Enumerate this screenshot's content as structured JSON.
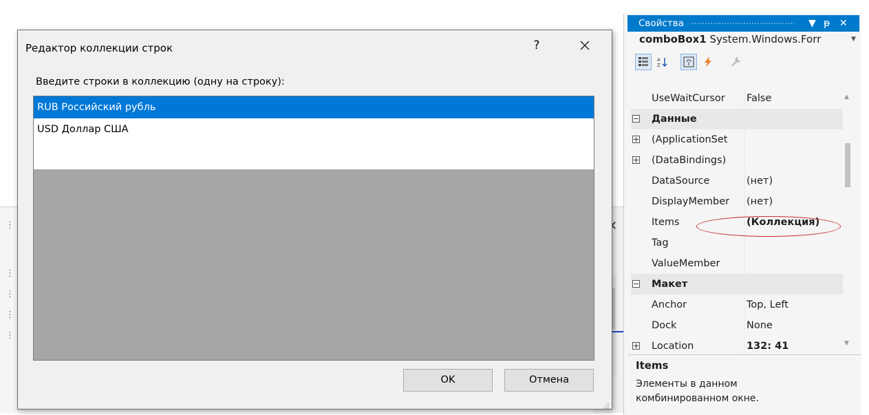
{
  "dialog": {
    "title": "Редактор коллекции строк",
    "help_label": "?",
    "prompt": "Введите строки в коллекцию (одну на строку):",
    "lines": [
      "RUB Российский рубль",
      "USD Доллар США"
    ],
    "ok_label": "OK",
    "cancel_label": "Отмена"
  },
  "properties": {
    "title": "Свойства",
    "title_controls": [
      "▼",
      "ᵽ",
      "✕"
    ],
    "object_name": "comboBox1",
    "object_type": "System.Windows.Forr",
    "rows": [
      {
        "name": "UseWaitCursor",
        "value": "False"
      },
      {
        "name": "Данные",
        "value": ""
      },
      {
        "name": "(ApplicationSet",
        "value": ""
      },
      {
        "name": "(DataBindings)",
        "value": ""
      },
      {
        "name": "DataSource",
        "value": "(нет)"
      },
      {
        "name": "DisplayMember",
        "value": "(нет)"
      },
      {
        "name": "Items",
        "value": "(Коллекция)"
      },
      {
        "name": "Tag",
        "value": ""
      },
      {
        "name": "ValueMember",
        "value": ""
      },
      {
        "name": "Макет",
        "value": ""
      },
      {
        "name": "Anchor",
        "value": "Top, Left"
      },
      {
        "name": "Dock",
        "value": "None"
      },
      {
        "name": "Location",
        "value": "132: 41"
      }
    ],
    "description_title": "Items",
    "description_text": "Элементы в данном комбинированном окне."
  },
  "colors": {
    "selection": "#0078d7",
    "title_bar": "#007acc",
    "highlight_ellipse": "#c62828"
  }
}
